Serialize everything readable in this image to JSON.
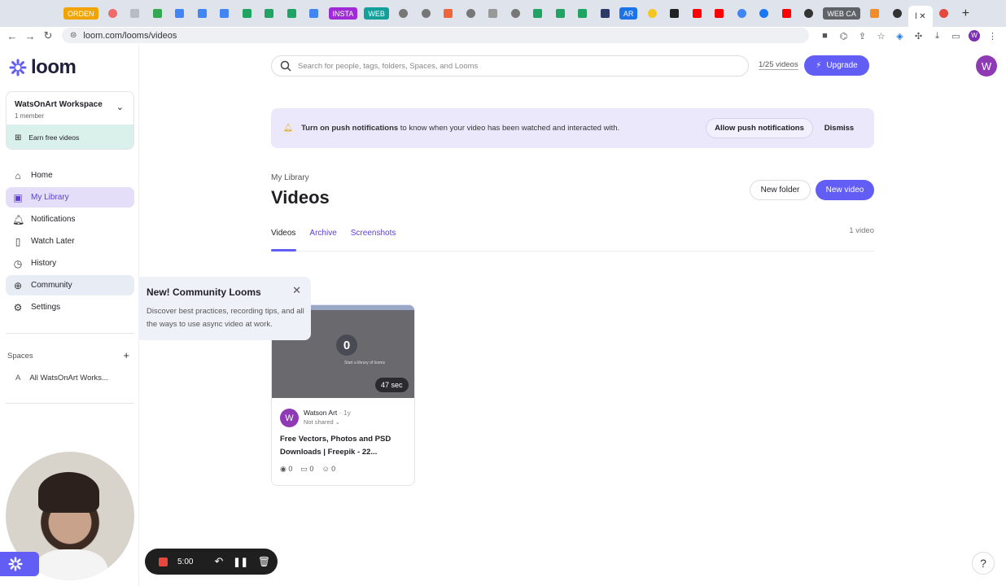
{
  "browser": {
    "tabs": [
      {
        "type": "text",
        "label": "ORDEN",
        "color": "#f1a400"
      },
      {
        "type": "icon",
        "icon": "asana-icon",
        "color": "#f06a6a",
        "shape": "round"
      },
      {
        "type": "icon",
        "icon": "blank-tab-icon",
        "color": "#b8bcc6"
      },
      {
        "type": "icon",
        "icon": "drive-icon",
        "color": "#34a853"
      },
      {
        "type": "icon",
        "icon": "docs-icon",
        "color": "#4285f4"
      },
      {
        "type": "icon",
        "icon": "docs-icon",
        "color": "#4285f4"
      },
      {
        "type": "icon",
        "icon": "docs-icon",
        "color": "#4285f4"
      },
      {
        "type": "icon",
        "icon": "sheets-plus-icon",
        "color": "#1fa463"
      },
      {
        "type": "icon",
        "icon": "sheets-plus-icon",
        "color": "#1fa463"
      },
      {
        "type": "icon",
        "icon": "sheets-plus-icon",
        "color": "#1fa463"
      },
      {
        "type": "icon",
        "icon": "slides-icon",
        "color": "#4285f4"
      },
      {
        "type": "text",
        "label": "INSTA",
        "color": "#a02bd6"
      },
      {
        "type": "text",
        "label": "WEB",
        "color": "#13a09a"
      },
      {
        "type": "icon",
        "icon": "wordpress-icon",
        "color": "#777777",
        "shape": "round"
      },
      {
        "type": "icon",
        "icon": "wordpress-icon",
        "color": "#777777",
        "shape": "round"
      },
      {
        "type": "icon",
        "icon": "blogger-icon",
        "color": "#f0643a"
      },
      {
        "type": "icon",
        "icon": "wordpress-icon",
        "color": "#777777",
        "shape": "round"
      },
      {
        "type": "icon",
        "icon": "diamond-icon",
        "color": "#999999"
      },
      {
        "type": "icon",
        "icon": "wordpress-icon",
        "color": "#777777",
        "shape": "round"
      },
      {
        "type": "icon",
        "icon": "sheets-plus-icon",
        "color": "#1fa463"
      },
      {
        "type": "icon",
        "icon": "sheets-plus-icon",
        "color": "#1fa463"
      },
      {
        "type": "icon",
        "icon": "sheets-plus-icon",
        "color": "#1fa463"
      },
      {
        "type": "icon",
        "icon": "k-icon",
        "color": "#2e3a66"
      },
      {
        "type": "text",
        "label": "AR",
        "color": "#1a73e8"
      },
      {
        "type": "icon",
        "icon": "yellow-circle-icon",
        "color": "#f3c623",
        "shape": "round"
      },
      {
        "type": "icon",
        "icon": "terminal-icon",
        "color": "#222222"
      },
      {
        "type": "icon",
        "icon": "youtube-icon",
        "color": "#ff0000"
      },
      {
        "type": "icon",
        "icon": "youtube-icon",
        "color": "#ff0000"
      },
      {
        "type": "icon",
        "icon": "google-icon",
        "color": "#4285f4",
        "shape": "round"
      },
      {
        "type": "icon",
        "icon": "meta-icon",
        "color": "#1877f2",
        "shape": "round"
      },
      {
        "type": "icon",
        "icon": "youtube-icon",
        "color": "#ff0000"
      },
      {
        "type": "icon",
        "icon": "globe-icon",
        "color": "#333333",
        "shape": "round"
      },
      {
        "type": "text",
        "label": "WEB CA",
        "color": "#5f6368"
      },
      {
        "type": "icon",
        "icon": "d-icon",
        "color": "#f28c28"
      },
      {
        "type": "icon",
        "icon": "timer-icon",
        "color": "#333333",
        "shape": "round"
      }
    ],
    "active_tab_label": "l",
    "url": "loom.com/looms/videos"
  },
  "app": {
    "logo_text": "loom",
    "brand_color": "#625df5",
    "workspace": {
      "name": "WatsOnArt Workspace",
      "members": "1 member",
      "earn_label": "Earn free videos"
    },
    "nav": [
      {
        "label": "Home",
        "icon": "home-icon",
        "glyph": "⌂",
        "state": "default"
      },
      {
        "label": "My Library",
        "icon": "library-icon",
        "glyph": "▣",
        "state": "active"
      },
      {
        "label": "Notifications",
        "icon": "bell-icon",
        "glyph": "🔔︎",
        "state": "default"
      },
      {
        "label": "Watch Later",
        "icon": "bookmark-icon",
        "glyph": "▯",
        "state": "default"
      },
      {
        "label": "History",
        "icon": "clock-icon",
        "glyph": "◷",
        "state": "default"
      },
      {
        "label": "Community",
        "icon": "globe-icon",
        "glyph": "⊕",
        "state": "hover"
      },
      {
        "label": "Settings",
        "icon": "gear-icon",
        "glyph": "⚙",
        "state": "default"
      }
    ],
    "spaces": {
      "heading": "Spaces",
      "add_glyph": "+",
      "items": [
        {
          "letter": "A",
          "label": "All WatsOnArt Works..."
        }
      ]
    },
    "search_placeholder": "Search for people, tags, folders, Spaces, and Looms",
    "quota": "1/25 videos",
    "upgrade_label": "Upgrade",
    "user_initial": "W",
    "banner": {
      "bold": "Turn on push notifications",
      "text": " to know when your video has been watched and interacted with.",
      "allow_label": "Allow push notifications",
      "dismiss_label": "Dismiss"
    },
    "breadcrumb": "My Library",
    "page_title": "Videos",
    "new_folder_label": "New folder",
    "new_video_label": "New video",
    "tabs": [
      "Videos",
      "Archive",
      "Screenshots"
    ],
    "active_tab": "Videos",
    "video_count": "1 video",
    "tooltip": {
      "title": "New! Community Looms",
      "body": "Discover best practices, recording tips, and all the ways to use async video at work."
    },
    "video": {
      "thumb_number": "0",
      "thumb_caption": "Start a library of looms",
      "duration": "47 sec",
      "author": "Watson Art",
      "ago": "1y",
      "sharing": "Not shared",
      "title": "Free Vectors, Photos and PSD Downloads | Freepik - 22...",
      "views": "0",
      "comments": "0",
      "reactions": "0"
    },
    "recorder": {
      "time": "5:00"
    },
    "help_glyph": "?"
  }
}
